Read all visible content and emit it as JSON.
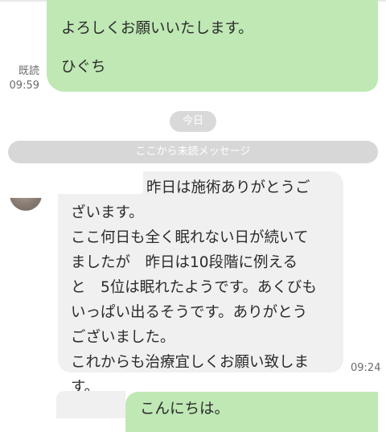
{
  "messages": {
    "outgoing_top": {
      "lines": [
        "よろしくお願いいたします。",
        "ひぐち"
      ],
      "read_label": "既読",
      "time": "09:59"
    },
    "date_separator": "今日",
    "unread_separator": "ここから未読メッセージ",
    "incoming": {
      "lines": [
        "昨日は施術ありがとうご",
        "ざいます。",
        "ここ何日も全く眠れない日が続いて",
        "ましたが　昨日は10段階に例える",
        "と　5位は眠れたようです。あくびも",
        "いっぱい出るそうです。ありがとう",
        "ございました。",
        "これからも治療宜しくお願い致しま",
        "す。"
      ],
      "time": "09:24"
    },
    "outgoing_bottom": {
      "text": "こんにちは。"
    }
  },
  "colors": {
    "outgoing_bubble": "#bfe8b4",
    "incoming_bubble": "#f0f0f0",
    "separator_pill": "#d7d7d7",
    "meta_text": "#6b6b6b"
  }
}
